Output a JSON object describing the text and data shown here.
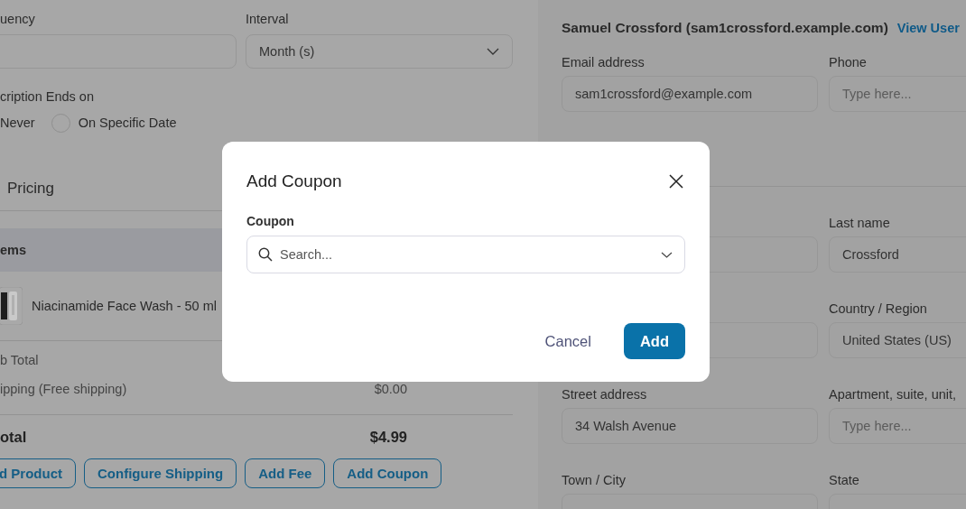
{
  "schedule": {
    "frequency_label": "uency",
    "interval": {
      "label": "Interval",
      "value": "Month (s)"
    },
    "ends_label": "cription Ends on",
    "end_options": [
      {
        "label": "Never"
      },
      {
        "label": "On Specific Date",
        "selected": false
      }
    ]
  },
  "pricing": {
    "title": "Pricing",
    "items_header": "ems",
    "products": [
      {
        "name": "Niacinamide Face Wash - 50 ml"
      }
    ],
    "summary": [
      {
        "label": "b Total"
      },
      {
        "label": "ipping (Free shipping)",
        "value": "$0.00"
      }
    ],
    "total": {
      "label": "otal",
      "value": "$4.99"
    },
    "buttons": [
      "d Product",
      "Configure Shipping",
      "Add Fee",
      "Add Coupon"
    ]
  },
  "customer": {
    "title": "Samuel Crossford (sam1crossford.example.com)",
    "link": "View User",
    "fields": [
      {
        "kind": "labeled",
        "label": "Email address",
        "value": "sam1crossford@example.com"
      },
      {
        "kind": "labeled",
        "label": "Phone",
        "placeholder": "Type here..."
      },
      {
        "kind": "spacer"
      },
      {
        "kind": "covered"
      },
      {
        "kind": "labeled",
        "label": "Last name",
        "value": "Crossford"
      },
      {
        "kind": "covered"
      },
      {
        "kind": "labeled",
        "label": "Country / Region",
        "value": "United States (US)"
      },
      {
        "kind": "labeled",
        "label": "Street address",
        "value": "34 Walsh Avenue"
      },
      {
        "kind": "labeled",
        "label": "Apartment, suite, unit,",
        "placeholder": "Type here..."
      },
      {
        "kind": "labeled",
        "label": "Town / City"
      },
      {
        "kind": "labeled",
        "label": "State"
      }
    ]
  },
  "dialog": {
    "title": "Add Coupon",
    "field_label": "Coupon",
    "placeholder": "Search...",
    "buttons": [
      {
        "kind": "secondary",
        "label": "Cancel"
      },
      {
        "kind": "primary",
        "label": "Add"
      }
    ]
  }
}
